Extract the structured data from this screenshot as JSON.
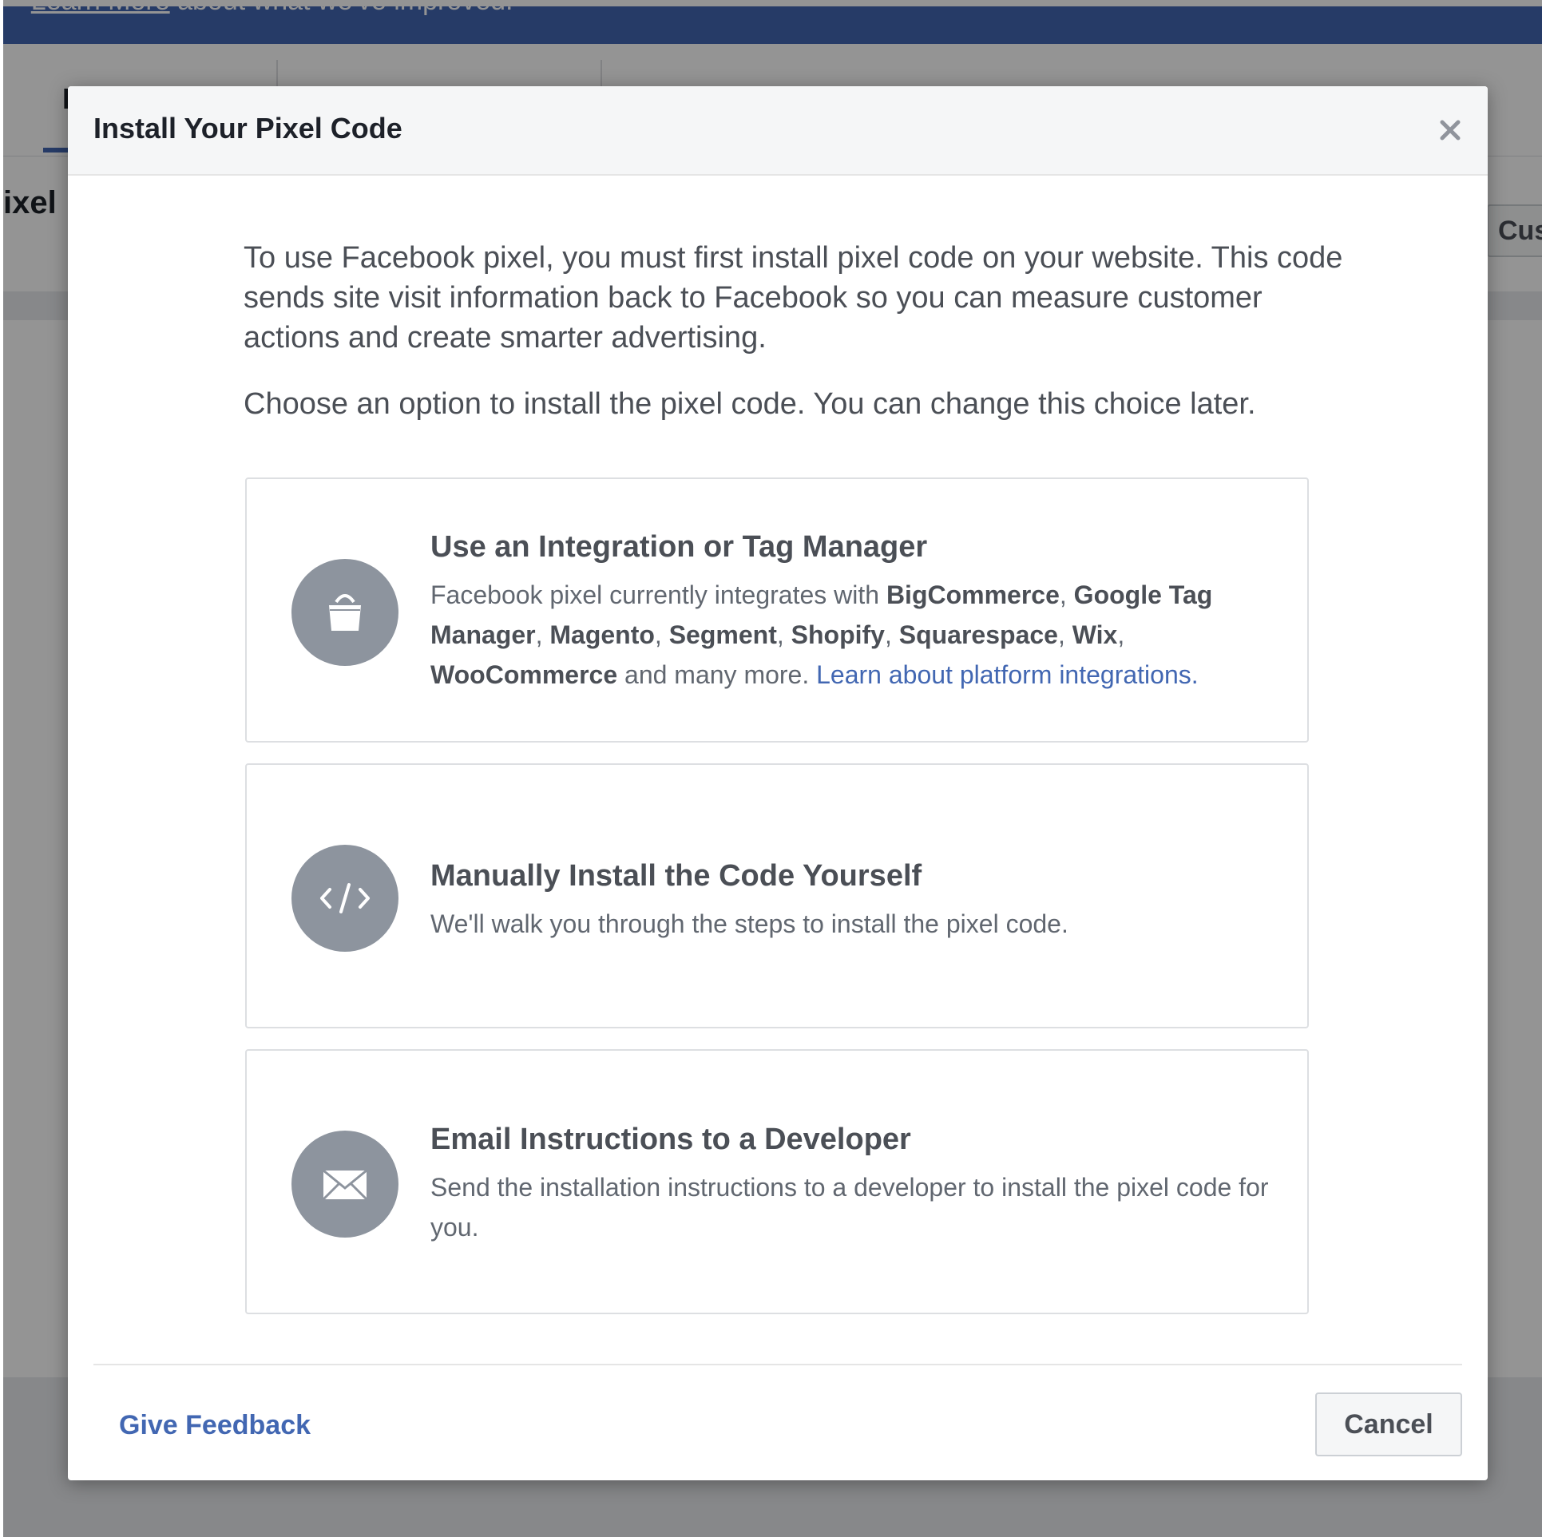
{
  "background": {
    "banner_lead": "Learn More about what we've improved.",
    "banner_link": "Learn More",
    "banner_rest": "about what we've improved.",
    "tab_partial": "D",
    "pixel_title_partial": "ixel",
    "cus_button_partial": "Cus"
  },
  "modal": {
    "title": "Install Your Pixel Code",
    "intro_p1": "To use Facebook pixel, you must first install pixel code on your website. This code sends site visit information back to Facebook so you can measure customer actions and create smarter advertising.",
    "intro_p2": "Choose an option to install the pixel code. You can change this choice later.",
    "options": [
      {
        "title": "Use an Integration or Tag Manager",
        "icon": "shopping-bag-icon",
        "desc_lead": "Facebook pixel currently integrates with",
        "partners": [
          "BigCommerce",
          "Google Tag Manager",
          "Magento",
          "Segment",
          "Shopify",
          "Squarespace",
          "Wix",
          "WooCommerce"
        ],
        "desc_tail": "and many more.",
        "link": "Learn about platform integrations."
      },
      {
        "title": "Manually Install the Code Yourself",
        "icon": "code-icon",
        "desc": "We'll walk you through the steps to install the pixel code."
      },
      {
        "title": "Email Instructions to a Developer",
        "icon": "envelope-icon",
        "desc": "Send the installation instructions to a developer to install the pixel code for you."
      }
    ],
    "footer": {
      "feedback_link": "Give Feedback",
      "cancel_label": "Cancel"
    }
  },
  "colors": {
    "brand_blue": "#4267b2",
    "icon_gray": "#8d949e",
    "text_dark": "#1d2129",
    "text_body": "#4b4f56"
  }
}
